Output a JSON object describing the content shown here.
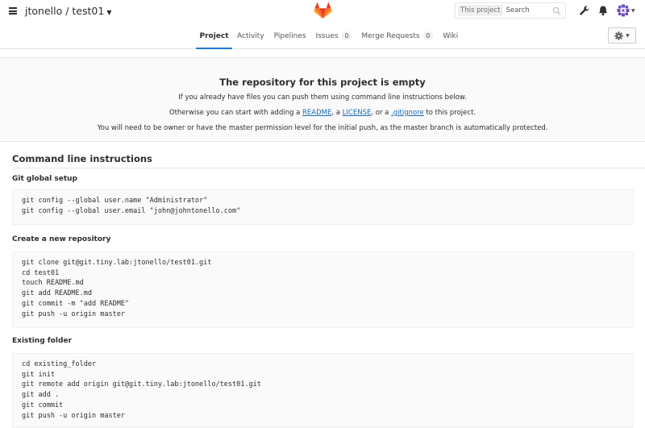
{
  "header": {
    "namespace": "jtonello",
    "project": "test01",
    "title": "jtonello / test01",
    "search_scope": "This project",
    "search_placeholder": "Search",
    "icons": [
      "menu-icon",
      "gitlab-logo",
      "search-icon",
      "wrench-icon",
      "bell-icon",
      "avatar"
    ]
  },
  "nav": {
    "tabs": [
      {
        "label": "Project",
        "active": true
      },
      {
        "label": "Activity"
      },
      {
        "label": "Pipelines"
      },
      {
        "label": "Issues",
        "count": "0"
      },
      {
        "label": "Merge Requests",
        "count": "0"
      },
      {
        "label": "Wiki"
      }
    ]
  },
  "empty": {
    "title": "The repository for this project is empty",
    "line1": "If you already have files you can push them using command line instructions below.",
    "line2_prefix": "Otherwise you can start with adding a ",
    "readme": "README",
    "sep1": ", a ",
    "license": "LICENSE",
    "sep2": ", or a ",
    "gitignore": ".gitignore",
    "line2_suffix": " to this project.",
    "line3": "You will need to be owner or have the master permission level for the initial push, as the master branch is automatically protected."
  },
  "cli": {
    "title": "Command line instructions",
    "sections": [
      {
        "title": "Git global setup",
        "lines": [
          "git config --global user.name \"Administrator\"",
          "git config --global user.email \"john@johntonello.com\""
        ]
      },
      {
        "title": "Create a new repository",
        "lines": [
          "git clone git@git.tiny.lab:jtonello/test01.git",
          "cd test01",
          "touch README.md",
          "git add README.md",
          "git commit -m \"add README\"",
          "git push -u origin master"
        ]
      },
      {
        "title": "Existing folder",
        "lines": [
          "cd existing_folder",
          "git init",
          "git remote add origin git@git.tiny.lab:jtonello/test01.git",
          "git add .",
          "git commit",
          "git push -u origin master"
        ]
      }
    ]
  },
  "colors": {
    "link": "#1b69b6",
    "active_tab_underline": "#1f78d1",
    "banner_bg": "#fafafa",
    "logo_orange": "#fc6d26",
    "logo_red": "#e24329",
    "logo_light": "#fca326",
    "avatar": "#6b4fbb"
  }
}
